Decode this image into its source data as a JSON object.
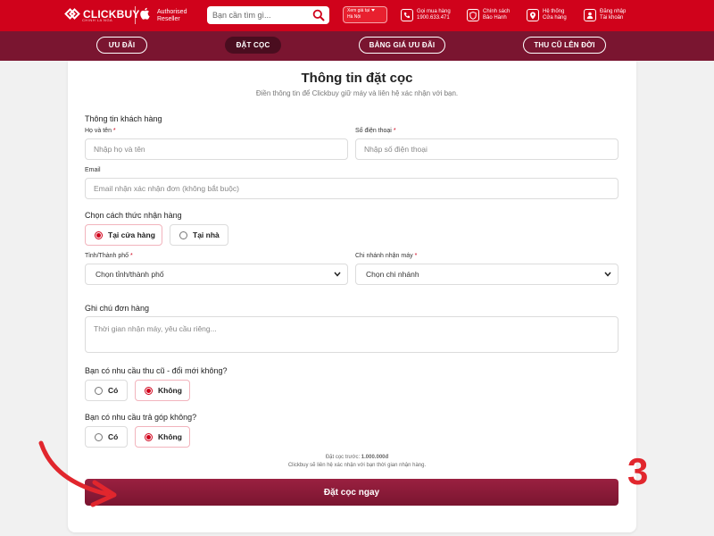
{
  "header": {
    "logo_text": "CLICKBUY",
    "logo_sub": "CHINH LA NGA",
    "reseller_line1": "Authorised",
    "reseller_line2": "Reseller",
    "search_placeholder": "Bạn cần tìm gì...",
    "location_label": "Xem giá tại",
    "location_value": "Hà Nội",
    "items": [
      {
        "line1": "Gọi mua hàng",
        "line2": "1900.633.471"
      },
      {
        "line1": "Chính sách",
        "line2": "Bảo Hành"
      },
      {
        "line1": "Hệ thống",
        "line2": "Cửa hàng"
      },
      {
        "line1": "Đăng nhập",
        "line2": "Tài khoản"
      }
    ]
  },
  "nav": {
    "items": [
      "ƯU ĐÃI",
      "ĐẶT CỌC",
      "BẢNG GIÁ ƯU ĐÃI",
      "THU CŨ LÊN ĐỜI"
    ]
  },
  "form": {
    "title": "Thông tin đặt cọc",
    "subtitle": "Điền thông tin để Clickbuy giữ máy và liên hệ xác nhận với bạn.",
    "customer_section": "Thông tin khách hàng",
    "name_label": "Họ và tên",
    "name_placeholder": "Nhập họ và tên",
    "phone_label": "Số điện thoại",
    "phone_placeholder": "Nhập số điện thoại",
    "email_label": "Email",
    "email_placeholder": "Email nhận xác nhận đơn (không bắt buộc)",
    "receive_section": "Chọn cách thức nhận hàng",
    "receive_options": [
      "Tại cửa hàng",
      "Tại nhà"
    ],
    "city_label": "Tỉnh/Thành phố",
    "city_value": "Chọn tỉnh/thành phố",
    "branch_label": "Chi nhánh nhận máy",
    "branch_value": "Chọn chi nhánh",
    "note_section": "Ghi chú đơn hàng",
    "note_placeholder": "Thời gian nhận máy, yêu cầu riêng...",
    "tradein_question": "Bạn có nhu cầu thu cũ - đổi mới không?",
    "installment_question": "Bạn có nhu cầu trả góp không?",
    "yes_label": "Có",
    "no_label": "Không",
    "required_mark": "*",
    "deposit_prefix": "Đặt cọc trước:",
    "deposit_amount": "1.000.000đ",
    "confirm_note": "Clickbuy sẽ liên hệ xác nhận với bạn thời gian nhận hàng.",
    "submit_label": "Đặt cọc ngay"
  },
  "annotation": {
    "step_number": "3",
    "color": "#e1262d"
  },
  "colors": {
    "brand_red": "#d0021b",
    "nav_maroon": "#7a1530",
    "active_nav": "#4a0d1f"
  }
}
